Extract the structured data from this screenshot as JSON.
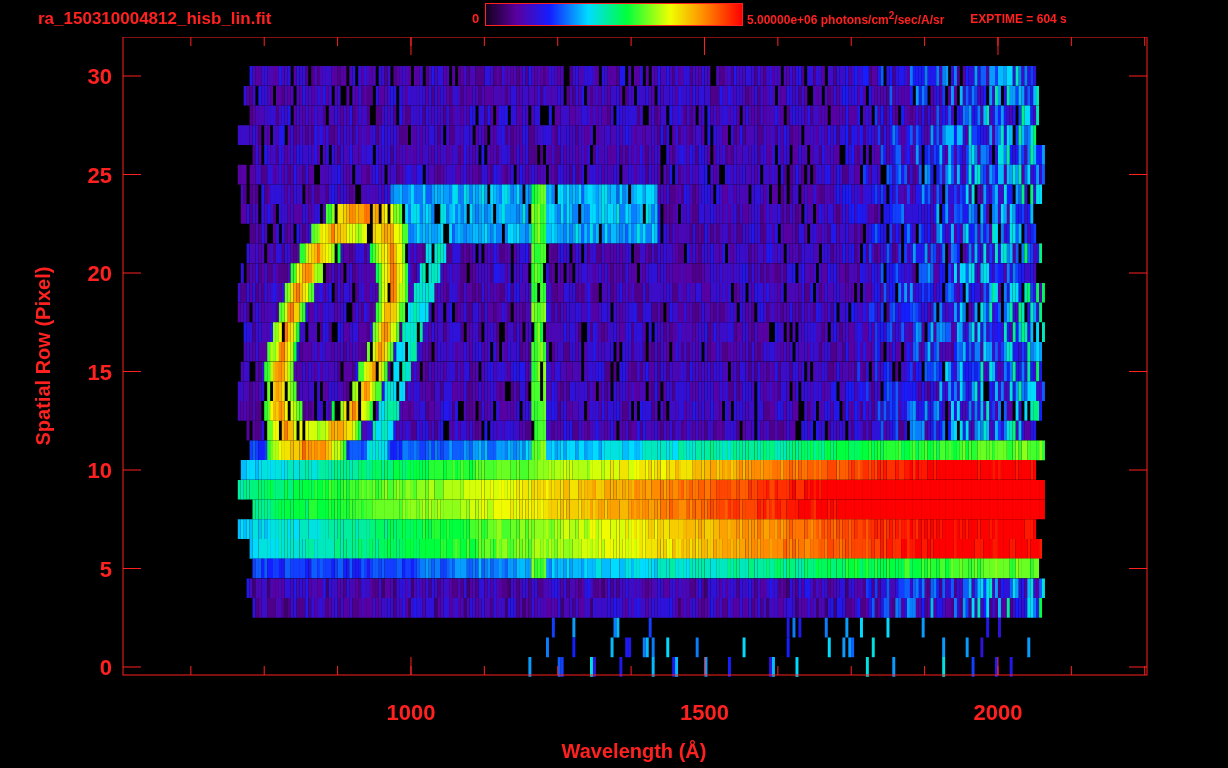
{
  "title": "ra_150310004812_hisb_lin.fit",
  "colorbar": {
    "min_label": "0",
    "max_label": "5.00000e+06 photons/cm$^{2}$/sec/A/sr"
  },
  "exposure": "EXPTIME = 604 s",
  "y_axis": {
    "label": "Spatial Row (Pixel)",
    "tick_labels": [
      "30",
      "25",
      "20",
      "15",
      "10",
      "5",
      "0"
    ]
  },
  "x_axis": {
    "label": "Wavelength (Å)",
    "tick_labels": [
      "1000",
      "1500",
      "2000"
    ]
  }
}
